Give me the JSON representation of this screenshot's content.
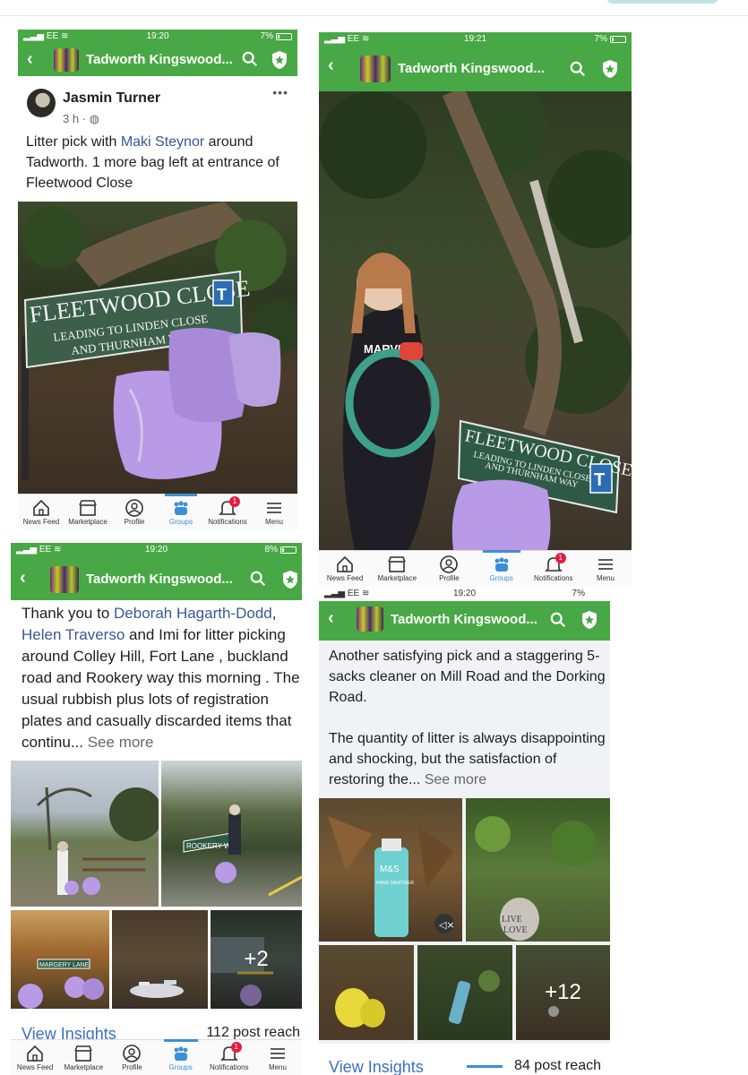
{
  "shots": {
    "s1": {
      "carrier": "EE",
      "time": "19:20",
      "battery": "7%",
      "group": "Tadworth Kingswood...",
      "author": "Jasmin Turner",
      "meta": "3 h ·",
      "text_a": "Litter pick with ",
      "tag": "Maki Steynor",
      "text_b": " around Tadworth. 1 more bag left at entrance of Fleetwood Close",
      "sign_l1": "FLEETWOOD CLOSE",
      "sign_l2": "LEADING TO LINDEN CLOSE",
      "sign_l3": "AND THURNHAM WAY",
      "sign_t": "T"
    },
    "s2": {
      "carrier": "EE",
      "time": "19:21",
      "battery": "7%",
      "group": "Tadworth Kingswood...",
      "sign_l1": "FLEETWOOD CLOSE",
      "sign_l2": "LEADING TO LINDEN CLOSE",
      "sign_l3": "AND THURNHAM WAY",
      "shirt": "MARVEL",
      "sign_t": "T"
    },
    "s3": {
      "carrier": "EE",
      "time": "19:20",
      "battery": "8%",
      "group": "Tadworth Kingswood...",
      "text_a": "Thank you to ",
      "tag1": "Deborah Hagarth-Dodd",
      "text_b": ", ",
      "tag2": "Helen Traverso",
      "text_c": " and Imi for litter picking around Colley Hill, Fort Lane , buckland road and Rookery way this morning . The usual rubbish plus lots of registration plates and casually discarded items that continu...",
      "see_more": " See more",
      "plus": "+2",
      "insights": "View Insights",
      "reach": "112 post reach",
      "rookery": "ROOKERY WAY",
      "margery": "MARGERY LANE"
    },
    "s4": {
      "carrier": "EE",
      "time": "19:20",
      "battery": "7%",
      "group": "Tadworth Kingswood...",
      "para1": "Another satisfying pick and a staggering 5-sacks cleaner on Mill Road and the Dorking Road.",
      "para2": "The quantity of litter is always disappointing and shocking, but the satisfaction of restoring the...",
      "see_more": " See more",
      "plus": "+12",
      "insights": "View Insights",
      "reach": "84 post reach",
      "bottle1": "M&S",
      "bottle2": "HAND SANITISER",
      "stone1": "LIVE",
      "stone2": "LOVE"
    }
  },
  "tabs": [
    "News Feed",
    "Marketplace",
    "Profile",
    "Groups",
    "Notifications",
    "Menu"
  ],
  "notification_count": "1",
  "colors": {
    "brand_green": "#48a845",
    "tab_active": "#3b8fd6",
    "link": "#385898",
    "bag_purple": "#b89ae6"
  }
}
